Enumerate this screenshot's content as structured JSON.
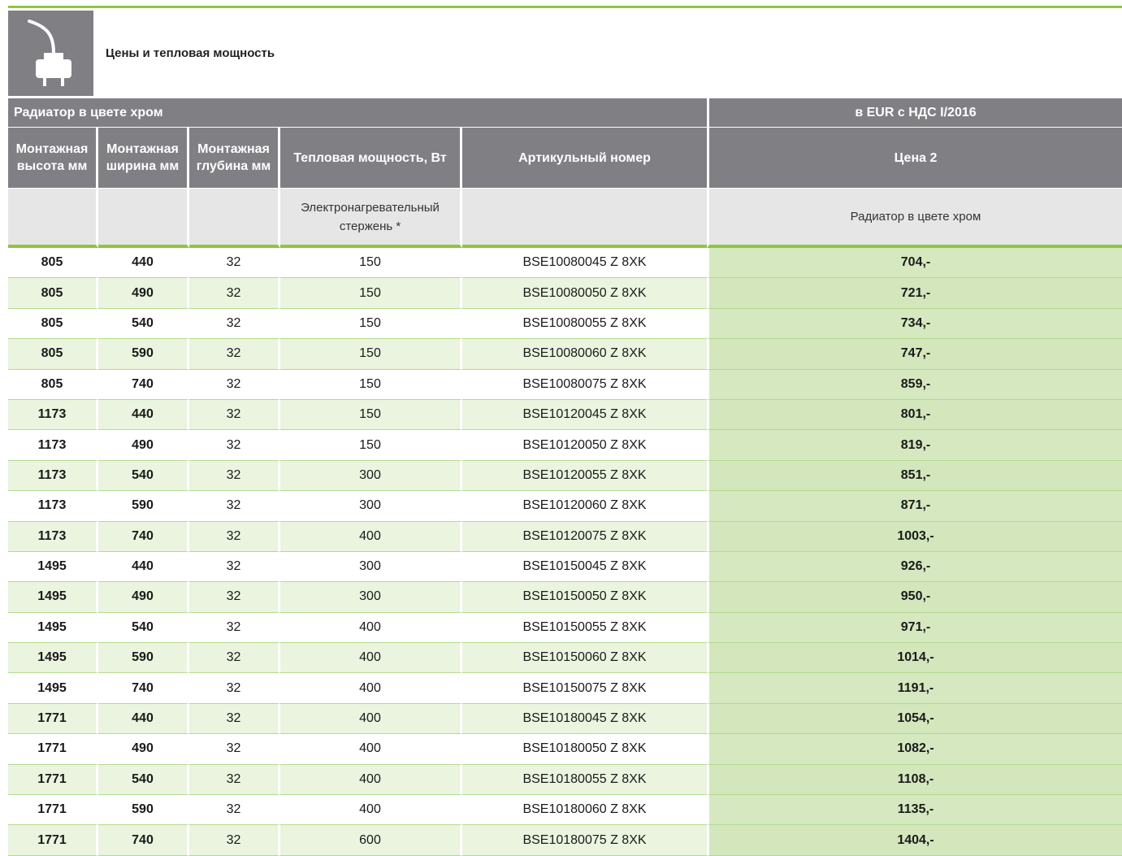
{
  "section": {
    "title": "Цены и тепловая мощность",
    "icon": "electric-plug-icon"
  },
  "colors": {
    "accent_green": "#8cc63f",
    "header_gray": "#807f84",
    "price_green": "#d5e8bf",
    "row_alt": "#eaf4de"
  },
  "table": {
    "group_left": "Радиатор в цвете хром",
    "group_right": "в EUR с НДС I/2016",
    "columns": {
      "height": "Монтажная высота мм",
      "width": "Монтажная ширина мм",
      "depth": "Монтажная глубина мм",
      "power": "Тепловая мощность, Вт",
      "article": "Артикульный номер",
      "price": "Цена 2"
    },
    "sub": {
      "power": "Электронагревательный стержень *",
      "price": "Радиатор в цвете хром"
    },
    "rows": [
      {
        "height": "805",
        "width": "440",
        "depth": "32",
        "power": "150",
        "article": "BSE10080045 Z 8XK",
        "price": "704,-"
      },
      {
        "height": "805",
        "width": "490",
        "depth": "32",
        "power": "150",
        "article": "BSE10080050 Z 8XK",
        "price": "721,-"
      },
      {
        "height": "805",
        "width": "540",
        "depth": "32",
        "power": "150",
        "article": "BSE10080055 Z 8XK",
        "price": "734,-"
      },
      {
        "height": "805",
        "width": "590",
        "depth": "32",
        "power": "150",
        "article": "BSE10080060 Z 8XK",
        "price": "747,-"
      },
      {
        "height": "805",
        "width": "740",
        "depth": "32",
        "power": "150",
        "article": "BSE10080075 Z 8XK",
        "price": "859,-"
      },
      {
        "height": "1173",
        "width": "440",
        "depth": "32",
        "power": "150",
        "article": "BSE10120045 Z 8XK",
        "price": "801,-"
      },
      {
        "height": "1173",
        "width": "490",
        "depth": "32",
        "power": "150",
        "article": "BSE10120050 Z 8XK",
        "price": "819,-"
      },
      {
        "height": "1173",
        "width": "540",
        "depth": "32",
        "power": "300",
        "article": "BSE10120055 Z 8XK",
        "price": "851,-"
      },
      {
        "height": "1173",
        "width": "590",
        "depth": "32",
        "power": "300",
        "article": "BSE10120060 Z 8XK",
        "price": "871,-"
      },
      {
        "height": "1173",
        "width": "740",
        "depth": "32",
        "power": "400",
        "article": "BSE10120075 Z 8XK",
        "price": "1003,-"
      },
      {
        "height": "1495",
        "width": "440",
        "depth": "32",
        "power": "300",
        "article": "BSE10150045 Z 8XK",
        "price": "926,-"
      },
      {
        "height": "1495",
        "width": "490",
        "depth": "32",
        "power": "300",
        "article": "BSE10150050 Z 8XK",
        "price": "950,-"
      },
      {
        "height": "1495",
        "width": "540",
        "depth": "32",
        "power": "400",
        "article": "BSE10150055 Z 8XK",
        "price": "971,-"
      },
      {
        "height": "1495",
        "width": "590",
        "depth": "32",
        "power": "400",
        "article": "BSE10150060 Z 8XK",
        "price": "1014,-"
      },
      {
        "height": "1495",
        "width": "740",
        "depth": "32",
        "power": "400",
        "article": "BSE10150075 Z 8XK",
        "price": "1191,-"
      },
      {
        "height": "1771",
        "width": "440",
        "depth": "32",
        "power": "400",
        "article": "BSE10180045 Z 8XK",
        "price": "1054,-"
      },
      {
        "height": "1771",
        "width": "490",
        "depth": "32",
        "power": "400",
        "article": "BSE10180050 Z 8XK",
        "price": "1082,-"
      },
      {
        "height": "1771",
        "width": "540",
        "depth": "32",
        "power": "400",
        "article": "BSE10180055 Z 8XK",
        "price": "1108,-"
      },
      {
        "height": "1771",
        "width": "590",
        "depth": "32",
        "power": "400",
        "article": "BSE10180060 Z 8XK",
        "price": "1135,-"
      },
      {
        "height": "1771",
        "width": "740",
        "depth": "32",
        "power": "600",
        "article": "BSE10180075 Z 8XK",
        "price": "1404,-"
      }
    ]
  }
}
